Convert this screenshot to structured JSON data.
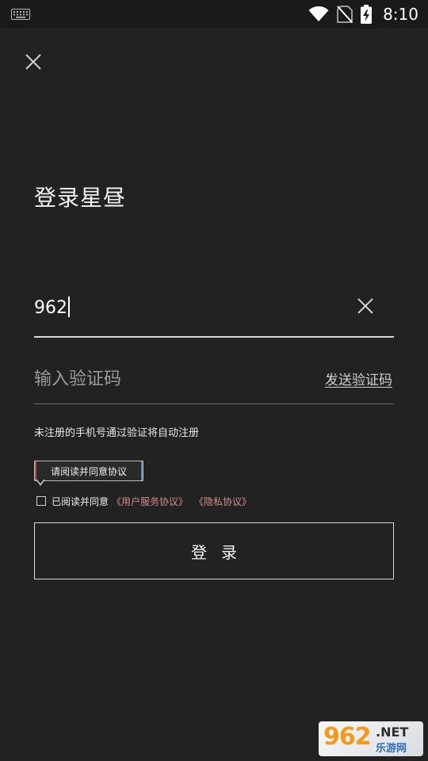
{
  "statusbar": {
    "time": "8:10",
    "icons": [
      "keyboard-icon",
      "wifi-icon",
      "no-sim-icon",
      "battery-charging-icon"
    ]
  },
  "page": {
    "title": "登录星昼"
  },
  "form": {
    "phone_value": "962",
    "code_placeholder": "输入验证码",
    "send_code_label": "发送验证码",
    "hint": "未注册的手机号通过验证将自动注册",
    "tooltip": "请阅读并同意协议",
    "agree_prefix": "已阅读并同意",
    "user_agreement": "《用户服务协议》",
    "privacy_policy": "《隐私协议》",
    "agree_checked": false,
    "login_label": "登录"
  },
  "watermark": {
    "number": "962",
    "domain": ".NET",
    "sub": "乐游网"
  },
  "colors": {
    "background": "#222222",
    "statusbar": "#1a1a1a",
    "link": "#d58a8a",
    "watermark_orange": "#f39a1d"
  }
}
